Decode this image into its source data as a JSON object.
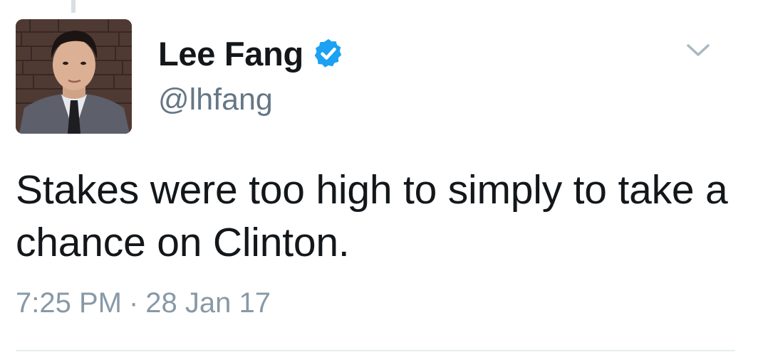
{
  "tweet": {
    "author": {
      "display_name": "Lee Fang",
      "handle": "@lhfang",
      "verified": true,
      "avatar_icon": "profile-photo"
    },
    "text": "Stakes were too high to simply to take a chance on Clinton.",
    "time": "7:25 PM",
    "separator": "·",
    "date": "28 Jan 17"
  },
  "icons": {
    "verified": "verified-badge-icon",
    "menu": "chevron-down-icon"
  },
  "colors": {
    "verified_blue": "#1da1f2",
    "secondary_text": "#657786",
    "timestamp_text": "#8899a6",
    "divider": "#e6ecf0"
  }
}
